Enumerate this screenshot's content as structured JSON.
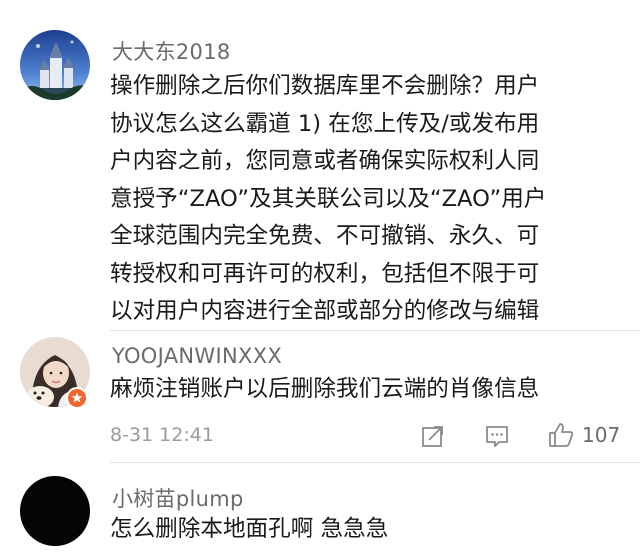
{
  "comments": [
    {
      "username": "大大东2018",
      "lines": [
        "操作删除之后你们数据库里不会删除？用户",
        "协议怎么这么霸道  1) 在您上传及/或发布用",
        "户内容之前，您同意或者确保实际权利人同",
        "意授予“ZAO”及其关联公司以及“ZAO”用户",
        "全球范围内完全免费、不可撤销、永久、可",
        "转授权和可再许可的权利，包括但不限于可",
        "以对用户内容进行全部或部分的修改与编辑"
      ]
    },
    {
      "username": "YOOJANWINXXX",
      "lines": [
        "麻烦注销账户以后删除我们云端的肖像信息"
      ],
      "timestamp": "8-31 12:41",
      "likes": "107"
    },
    {
      "username": "小树苗plump",
      "lines": [
        "怎么删除本地面孔啊 急急急"
      ]
    }
  ],
  "icons": {
    "share": "share-icon",
    "comment": "comment-icon",
    "like": "thumbs-up-icon"
  },
  "colors": {
    "username": "#6b6b6b",
    "text": "#1a1a1a",
    "meta": "#9a9a9a",
    "badge": "#f2662b"
  }
}
